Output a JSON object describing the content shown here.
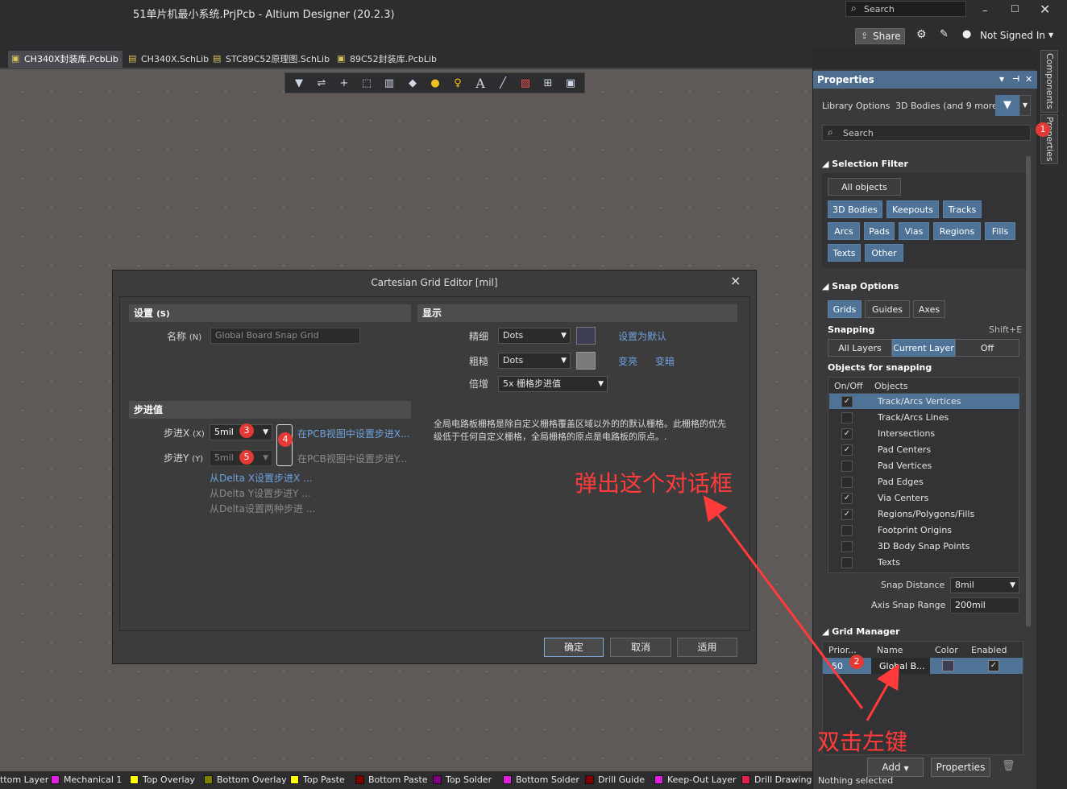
{
  "window": {
    "title": "51单片机最小系统.PrjPcb - Altium Designer (20.2.3)",
    "search_placeholder": "Search",
    "share_label": "Share",
    "account_label": "Not Signed In"
  },
  "tabs": [
    {
      "label": "CH340X封装库.PcbLib",
      "active": true
    },
    {
      "label": "CH340X.SchLib"
    },
    {
      "label": "STC89C52原理图.SchLib"
    },
    {
      "label": "89C52封装库.PcbLib"
    }
  ],
  "pcb_toolbar": {
    "icons": [
      "filter-icon",
      "route-icon",
      "cross-icon",
      "select-rect-icon",
      "align-icon",
      "component-icon",
      "pad-icon",
      "via-icon",
      "text-icon",
      "line-icon",
      "region-icon",
      "dimension-icon",
      "board-icon"
    ],
    "text_glyph": "A"
  },
  "layers": [
    {
      "name": "ttom Layer",
      "color": "#1f3ae8"
    },
    {
      "name": "Mechanical 1",
      "color": "#e020e0"
    },
    {
      "name": "Top Overlay",
      "color": "#ffff00"
    },
    {
      "name": "Bottom Overlay",
      "color": "#808000"
    },
    {
      "name": "Top Paste",
      "color": "#ffff00"
    },
    {
      "name": "Bottom Paste",
      "color": "#800000"
    },
    {
      "name": "Top Solder",
      "color": "#800080"
    },
    {
      "name": "Bottom Solder",
      "color": "#e020e0"
    },
    {
      "name": "Drill Guide",
      "color": "#800000"
    },
    {
      "name": "Keep-Out Layer",
      "color": "#e020e0"
    },
    {
      "name": "Drill Drawing",
      "color": "#e0204a"
    }
  ],
  "dialog": {
    "title": "Cartesian Grid Editor [mil]",
    "settings_header": "设置",
    "settings_hotkey": "(S)",
    "name_label": "名称",
    "name_hotkey": "(N)",
    "name_value": "Global Board Snap Grid",
    "display_header": "显示",
    "fine_label": "精细",
    "fine_value": "Dots",
    "coarse_label": "粗糙",
    "coarse_value": "Dots",
    "multiplier_label": "倍增",
    "multiplier_value": "5x 栅格步进值",
    "set_default": "设置为默认",
    "lighten": "变亮",
    "darken": "变暗",
    "step_header": "步进值",
    "step_x_label": "步进X",
    "step_x_hotkey": "(X)",
    "step_x_value": "5mil",
    "step_y_label": "步进Y",
    "step_y_hotkey": "(Y)",
    "step_y_value": "5mil",
    "set_in_pcb_x": "在PCB视图中设置步进X...",
    "set_in_pcb_y": "在PCB视图中设置步进Y...",
    "from_delta_x": "从Delta X设置步进X ...",
    "from_delta_y": "从Delta Y设置步进Y ...",
    "from_delta_both": "从Delta设置两种步进 ...",
    "description": "全局电路板栅格是除自定义栅格覆盖区域以外的的默认栅格。此栅格的优先级低于任何自定义栅格，全局栅格的原点是电路板的原点。.",
    "ok": "确定",
    "cancel": "取消",
    "apply": "适用",
    "close_glyph": "×"
  },
  "panel": {
    "title": "Properties",
    "library_options": "Library Options",
    "bodies_label": "3D Bodies (and 9 more)",
    "search_placeholder": "Search",
    "selection_filter": "Selection Filter",
    "all_objects": "All objects",
    "filter_chips": [
      "3D Bodies",
      "Keepouts",
      "Tracks",
      "Arcs",
      "Pads",
      "Vias",
      "Regions",
      "Fills",
      "Texts",
      "Other"
    ],
    "snap_options": "Snap Options",
    "snap_chips": [
      "Grids",
      "Guides",
      "Axes"
    ],
    "snapping_label": "Snapping",
    "snapping_shortcut": "Shift+E",
    "snapping_modes": [
      "All Layers",
      "Current Layer",
      "Off"
    ],
    "objects_for_snapping": "Objects for snapping",
    "col_onoff": "On/Off",
    "col_objects": "Objects",
    "snap_objects": [
      {
        "name": "Track/Arcs Vertices",
        "checked": true
      },
      {
        "name": "Track/Arcs Lines",
        "checked": false
      },
      {
        "name": "Intersections",
        "checked": true
      },
      {
        "name": "Pad Centers",
        "checked": true
      },
      {
        "name": "Pad Vertices",
        "checked": false
      },
      {
        "name": "Pad Edges",
        "checked": false
      },
      {
        "name": "Via Centers",
        "checked": true
      },
      {
        "name": "Regions/Polygons/Fills",
        "checked": true
      },
      {
        "name": "Footprint Origins",
        "checked": false
      },
      {
        "name": "3D Body Snap Points",
        "checked": false
      },
      {
        "name": "Texts",
        "checked": false
      }
    ],
    "snap_distance_label": "Snap Distance",
    "snap_distance_value": "8mil",
    "axis_snap_label": "Axis Snap Range",
    "axis_snap_value": "200mil",
    "grid_manager": "Grid Manager",
    "gm_cols": [
      "Prior...",
      "Name",
      "Color",
      "Enabled"
    ],
    "gm_row": {
      "priority": "50",
      "name": "Global B..."
    },
    "add_label": "Add",
    "properties_label": "Properties",
    "status": "Nothing selected",
    "side_tabs": [
      "Components",
      "Properties"
    ]
  },
  "annotations": {
    "popup_text": "弹出这个对话框",
    "doubleclick_text": "双击左键",
    "badges": [
      "1",
      "2",
      "3",
      "4",
      "5"
    ]
  }
}
